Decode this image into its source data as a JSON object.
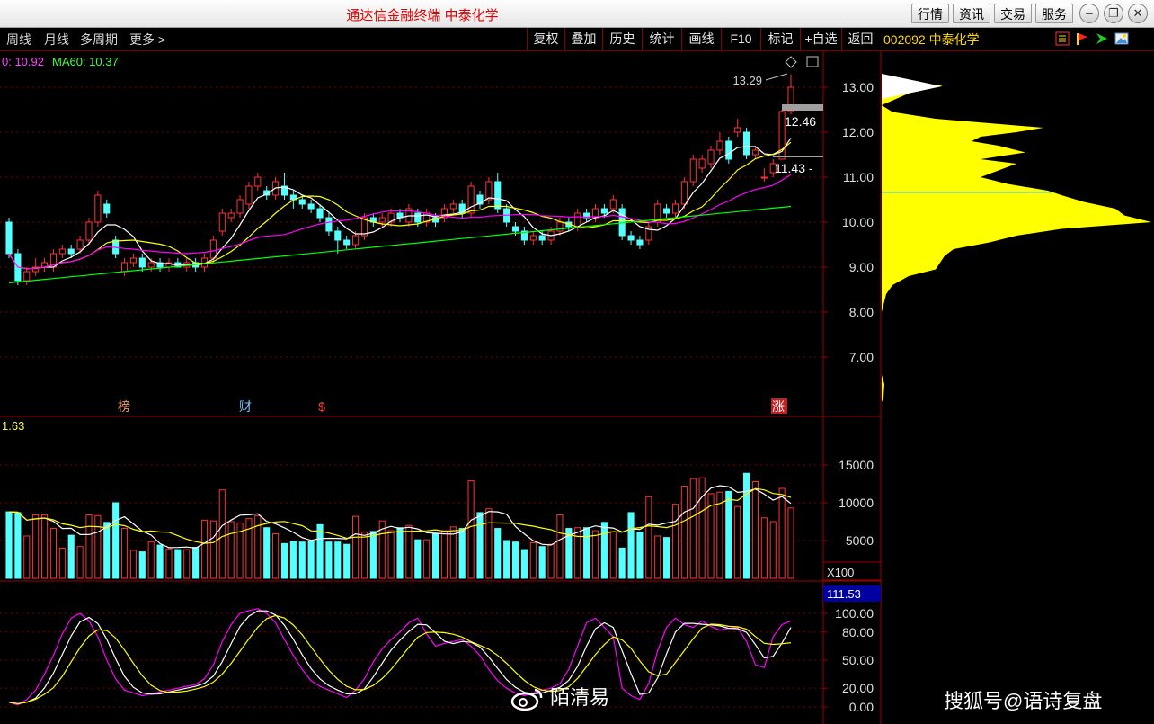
{
  "window": {
    "title": "通达信金融终端  中泰化学",
    "buttons": [
      "行情",
      "资讯",
      "交易",
      "服务"
    ]
  },
  "toolbar": {
    "periods": [
      "周线",
      "月线",
      "多周期",
      "更多 >"
    ],
    "tools": [
      "复权",
      "叠加",
      "历史",
      "统计",
      "画线",
      "F10",
      "标记",
      "+自选",
      "返回"
    ],
    "stock": "002092 中泰化学"
  },
  "price_panel": {
    "ma_text_1": "0: 10.92",
    "ma_text_2": "MA60: 10.37",
    "y_ticks": [
      "13.00",
      "12.00",
      "11.00",
      "10.00",
      "9.00",
      "8.00",
      "7.00"
    ],
    "high_label": "13.29",
    "marker_upper": "12.46",
    "marker_lower": "11.43 -",
    "event_tags": [
      "榜",
      "财",
      "$",
      "涨"
    ]
  },
  "volume_panel": {
    "value_text": "1.63",
    "y_ticks": [
      "15000",
      "10000",
      "5000"
    ],
    "unit": "X100"
  },
  "indicator_panel": {
    "current_value": "111.53",
    "y_ticks": [
      "100.00",
      "80.00",
      "50.00",
      "20.00",
      "0.00"
    ]
  },
  "watermarks": {
    "left": "陌清易",
    "right": "搜狐号@语诗复盘"
  },
  "colors": {
    "up": "#ff3232",
    "down": "#54ffff",
    "ma_white": "#ffffff",
    "ma_yellow": "#ffff00",
    "ma_magenta": "#ff00ff",
    "ma_green": "#00ff00",
    "volume_profile": "#ffff00",
    "panel_border": "#a00000"
  }
}
